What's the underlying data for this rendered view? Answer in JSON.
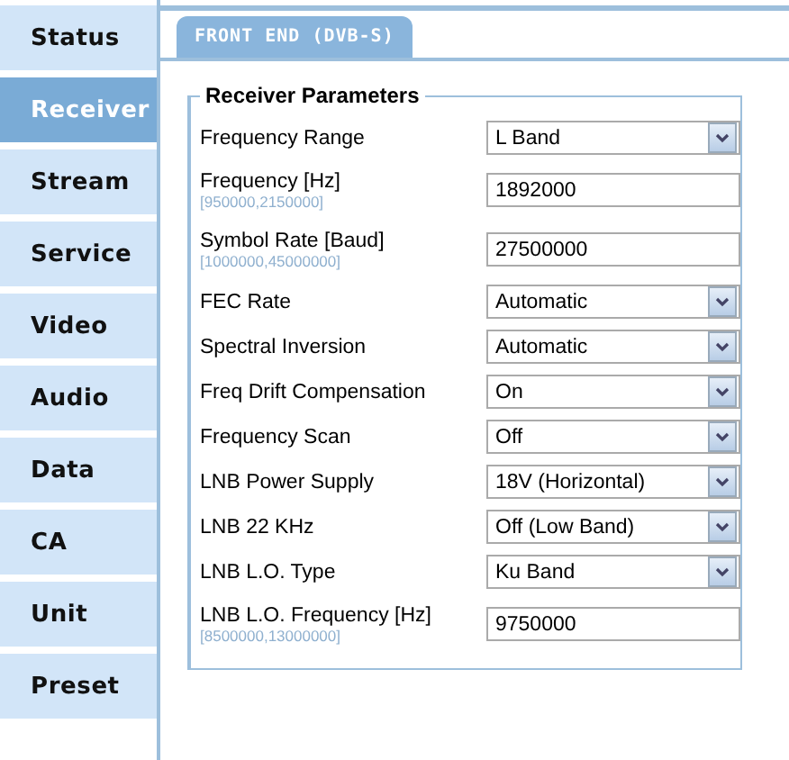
{
  "sidebar": {
    "items": [
      {
        "label": "Status",
        "selected": false
      },
      {
        "label": "Receiver",
        "selected": true
      },
      {
        "label": "Stream",
        "selected": false
      },
      {
        "label": "Service",
        "selected": false
      },
      {
        "label": "Video",
        "selected": false
      },
      {
        "label": "Audio",
        "selected": false
      },
      {
        "label": "Data",
        "selected": false
      },
      {
        "label": "CA",
        "selected": false
      },
      {
        "label": "Unit",
        "selected": false
      },
      {
        "label": "Preset",
        "selected": false
      }
    ]
  },
  "tab": {
    "label": "FRONT END (DVB-S)"
  },
  "group": {
    "title": "Receiver Parameters",
    "rows": [
      {
        "kind": "select",
        "label": "Frequency Range",
        "value": "L Band"
      },
      {
        "kind": "input",
        "label": "Frequency [Hz]",
        "hint": "[950000,2150000]",
        "value": "1892000"
      },
      {
        "kind": "input",
        "label": "Symbol Rate [Baud]",
        "hint": "[1000000,45000000]",
        "value": "27500000"
      },
      {
        "kind": "select",
        "label": "FEC Rate",
        "value": "Automatic"
      },
      {
        "kind": "select",
        "label": "Spectral Inversion",
        "value": "Automatic"
      },
      {
        "kind": "select",
        "label": "Freq Drift Compensation",
        "value": "On"
      },
      {
        "kind": "select",
        "label": "Frequency Scan",
        "value": "Off"
      },
      {
        "kind": "select",
        "label": "LNB Power Supply",
        "value": "18V (Horizontal)"
      },
      {
        "kind": "select",
        "label": "LNB 22 KHz",
        "value": "Off (Low Band)"
      },
      {
        "kind": "select",
        "label": "LNB L.O. Type",
        "value": "Ku Band"
      },
      {
        "kind": "input",
        "label": "LNB L.O. Frequency [Hz]",
        "hint": "[8500000,13000000]",
        "value": "9750000"
      }
    ]
  }
}
